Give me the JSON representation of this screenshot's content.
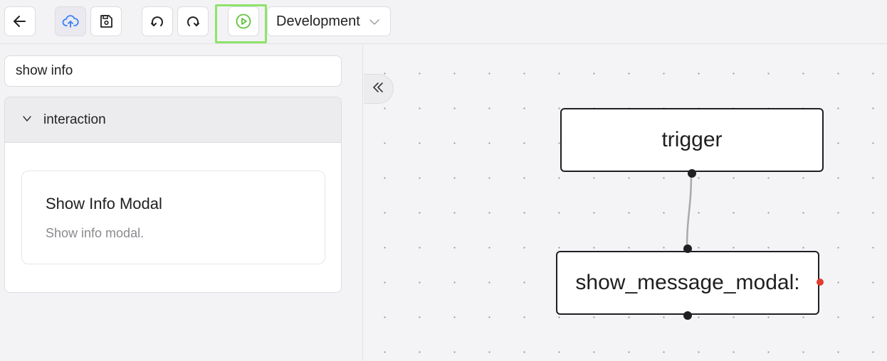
{
  "toolbar": {
    "buttons": [
      {
        "name": "back-button",
        "icon": "arrow-left-icon"
      },
      {
        "name": "deploy-button",
        "icon": "cloud-upload-icon"
      },
      {
        "name": "save-button",
        "icon": "floppy-disk-icon"
      },
      {
        "name": "undo-button",
        "icon": "undo-icon"
      },
      {
        "name": "redo-button",
        "icon": "redo-icon"
      },
      {
        "name": "run-button",
        "icon": "play-circle-icon"
      }
    ],
    "environment": "Development"
  },
  "sidebar": {
    "search_value": "show info",
    "group_label": "interaction",
    "card": {
      "title": "Show Info Modal",
      "description": "Show info modal."
    }
  },
  "canvas": {
    "nodes": [
      {
        "id": "trigger",
        "label": "trigger"
      },
      {
        "id": "show_message_modal",
        "label": "show_message_modal:"
      }
    ]
  },
  "colors": {
    "accent_blue": "#3b82f6",
    "run_green": "#5fc33b",
    "highlight_green": "#8ee36a",
    "error_red": "#e23b30"
  }
}
